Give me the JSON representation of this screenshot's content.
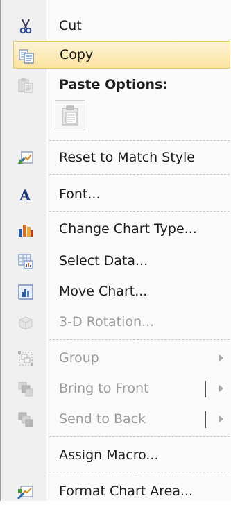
{
  "menu": {
    "items": [
      {
        "id": "cut",
        "label": "Cut",
        "icon": "scissors-icon",
        "enabled": true
      },
      {
        "id": "copy",
        "label": "Copy",
        "icon": "copy-icon",
        "enabled": true,
        "highlighted": true
      },
      {
        "id": "paste-options",
        "label": "Paste Options:",
        "icon": "paste-icon",
        "enabled": true
      },
      {
        "id": "paste-keep",
        "icon": "paste-picture-icon",
        "enabled": true
      },
      {
        "id": "reset-style",
        "label": "Reset to Match Style",
        "icon": "reset-style-icon",
        "enabled": true
      },
      {
        "id": "font",
        "label": "Font...",
        "icon": "font-icon",
        "enabled": true
      },
      {
        "id": "change-chart-type",
        "label": "Change Chart Type...",
        "icon": "bar-chart-icon",
        "enabled": true
      },
      {
        "id": "select-data",
        "label": "Select Data...",
        "icon": "select-data-icon",
        "enabled": true
      },
      {
        "id": "move-chart",
        "label": "Move Chart...",
        "icon": "move-chart-icon",
        "enabled": true
      },
      {
        "id": "rotation",
        "label": "3-D Rotation...",
        "icon": "cube-icon",
        "enabled": false
      },
      {
        "id": "group",
        "label": "Group",
        "icon": "group-icon",
        "enabled": false,
        "submenu": true
      },
      {
        "id": "bring-front",
        "label": "Bring to Front",
        "icon": "bring-front-icon",
        "enabled": false,
        "submenu": true,
        "split": true
      },
      {
        "id": "send-back",
        "label": "Send to Back",
        "icon": "send-back-icon",
        "enabled": false,
        "submenu": true,
        "split": true
      },
      {
        "id": "assign-macro",
        "label": "Assign Macro...",
        "enabled": true
      },
      {
        "id": "format-chart-area",
        "label": "Format Chart Area...",
        "icon": "format-chart-area-icon",
        "enabled": true
      }
    ]
  },
  "colors": {
    "highlight_fill": "#fbe3a0",
    "highlight_border": "#e7c669",
    "disabled_text": "#9c9c9c",
    "gutter": "#f0f0f0"
  }
}
